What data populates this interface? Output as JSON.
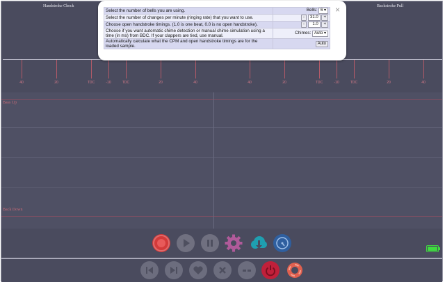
{
  "panels": {
    "left_title": "Handstroke Check",
    "right_title": "Backstroke Pull"
  },
  "scale_left": {
    "labels": [
      "40",
      "20",
      "TDC",
      "-10",
      "TDC",
      "20",
      "40"
    ]
  },
  "scale_right": {
    "labels": [
      "40",
      "20",
      "TDC",
      "-10",
      "TDC",
      "20",
      "40"
    ]
  },
  "plot": {
    "top_label": "Bass Up",
    "bottom_label": "Back Down"
  },
  "dialog": {
    "close_symbol": "×",
    "rows": [
      {
        "desc": "Select the number of bells you are using.",
        "label": "Bells:",
        "value": "6"
      },
      {
        "desc": "Select the number of changes per minute (ringing rate) that you want to use.",
        "minus": "-",
        "value": "31.0",
        "plus": "+"
      },
      {
        "desc": "Choose open handstroke timings. (1.0 is one beat, 0.0 is no open handstroke).",
        "minus": "-",
        "value": "1.0",
        "plus": "+"
      },
      {
        "desc": "Choose if you want automatic chime detection or manual chime simulation using a time (in ms) from BDC. If your clappers are tied, use manual.",
        "label": "Chimes:",
        "value": "Auto"
      },
      {
        "desc": "Automatically calculate what the CPM and open handstroke timings are for the loaded sample.",
        "button": "Auto"
      }
    ]
  },
  "colors": {
    "record": "#d33a3a",
    "settings": "#b05a9a",
    "download": "#1f9fb0",
    "gauge": "#2f5f9f",
    "power": "#c0203a",
    "help": "#e0604f",
    "battery": "#3fdc3f",
    "muted": "#707080"
  },
  "icons": {
    "top": [
      "record-icon",
      "play-icon",
      "pause-icon",
      "gear-icon",
      "cloud-download-icon",
      "gauge-icon"
    ],
    "bottom": [
      "skip-back-icon",
      "skip-forward-icon",
      "heart-icon",
      "close-icon",
      "minus-icon",
      "power-icon",
      "lifebuoy-icon"
    ]
  }
}
